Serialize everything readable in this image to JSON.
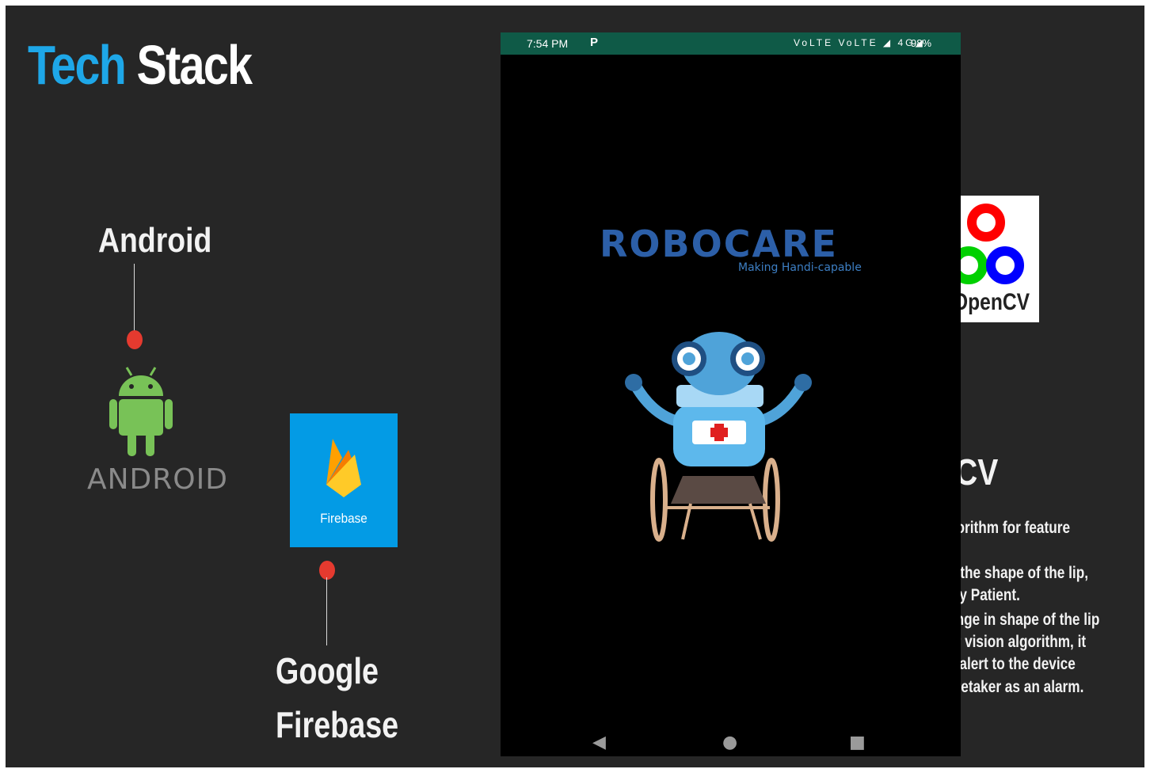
{
  "slide": {
    "title_part1": "Tech",
    "title_part2": "Stack"
  },
  "android": {
    "label": "Android",
    "logo_word": "ANDROID"
  },
  "firebase": {
    "tile_text": "Firebase",
    "label_line1": "Google",
    "label_line2": "Firebase"
  },
  "opencv": {
    "logo_word": "OpenCV",
    "heading_partial": "CV",
    "description_lines": [
      "gorithm for feature",
      "n the shape of the lip,",
      "lsy Patient.",
      "ange in shape of the lip",
      "er vision algorithm, it",
      "s alert to the device",
      "aretaker as an alarm."
    ]
  },
  "phone": {
    "status": {
      "time": "7:54 PM",
      "notification_icon": "P",
      "icons": "VoLTE VoLTE ◢ 4G◢",
      "battery": "98%"
    },
    "app_logo": "ROBOCARE",
    "app_tagline": "Making Handi-capable",
    "nav": {
      "back": "◀",
      "home": "●",
      "recents": "■"
    }
  },
  "colors": {
    "accent_blue": "#1ea7e8",
    "slide_bg": "#262626",
    "status_bar": "#0f5a47",
    "firebase_blue": "#039be5",
    "pin_red": "#e53a2f",
    "android_green": "#78c257"
  }
}
